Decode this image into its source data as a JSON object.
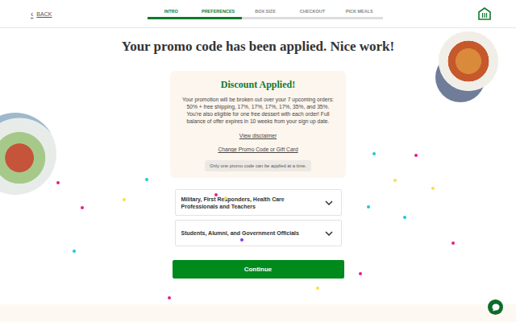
{
  "header": {
    "back_icon": "‹",
    "back": "BACK"
  },
  "steps": [
    {
      "label": "INTRO",
      "active": true
    },
    {
      "label": "PREFERENCES",
      "active": true
    },
    {
      "label": "BOX SIZE",
      "active": false
    },
    {
      "label": "CHECKOUT",
      "active": false
    },
    {
      "label": "PICK MEALS",
      "active": false
    }
  ],
  "title": "Your promo code has been applied. Nice work!",
  "discount": {
    "heading": "Discount Applied!",
    "body": "Your promotion will be broken out over your 7 upcoming orders: 50% + free shipping, 17%, 17%, 17%, 17%, 35%, and 35%. You're also eligible for one free dessert with each order! Full balance of offer expires in 10 weeks from your sign up date.",
    "links": [
      "View disclaimer",
      "Change Promo Code or Gift Card"
    ],
    "note": "Only one promo code can be applied at a time."
  },
  "accordions": [
    {
      "label": "Military, First Responders, Health Care Professionals and Teachers",
      "expanded": false
    },
    {
      "label": "Students, Alumni, and Government Officials",
      "expanded": false
    }
  ],
  "button": "Continue"
}
